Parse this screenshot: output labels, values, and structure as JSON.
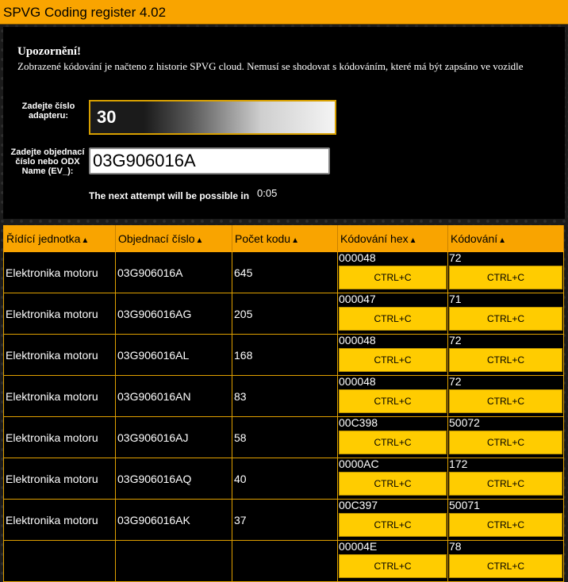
{
  "app": {
    "title": "SPVG Coding register 4.02"
  },
  "notice": {
    "title": "Upozornění!",
    "text": "Zobrazené kódování je načteno z historie SPVG cloud. Nemusí se shodovat s kódováním, které má být zapsáno ve vozidle"
  },
  "form": {
    "adapter_label": "Zadejte číslo adapteru:",
    "adapter_value": "30",
    "part_label": "Zadejte objednací číslo nebo ODX Name (EV_):",
    "part_value": "03G906016A",
    "attempt_text": "The next attempt will be possible in",
    "timer": "0:05"
  },
  "table": {
    "headers": [
      "Řídící jednotka",
      "Objednací číslo",
      "Počet kodu",
      "Kódování hex",
      "Kódování"
    ],
    "sort_glyph": "▲",
    "copy_label": "CTRL+C",
    "rows": [
      {
        "unit": "Elektronika motoru",
        "part": "03G906016A",
        "count": "645",
        "hex": "000048",
        "dec": "72"
      },
      {
        "unit": "Elektronika motoru",
        "part": "03G906016AG",
        "count": "205",
        "hex": "000047",
        "dec": "71"
      },
      {
        "unit": "Elektronika motoru",
        "part": "03G906016AL",
        "count": "168",
        "hex": "000048",
        "dec": "72"
      },
      {
        "unit": "Elektronika motoru",
        "part": "03G906016AN",
        "count": "83",
        "hex": "000048",
        "dec": "72"
      },
      {
        "unit": "Elektronika motoru",
        "part": "03G906016AJ",
        "count": "58",
        "hex": "00C398",
        "dec": "50072"
      },
      {
        "unit": "Elektronika motoru",
        "part": "03G906016AQ",
        "count": "40",
        "hex": "0000AC",
        "dec": "172"
      },
      {
        "unit": "Elektronika motoru",
        "part": "03G906016AK",
        "count": "37",
        "hex": "00C397",
        "dec": "50071"
      },
      {
        "unit": "",
        "part": "",
        "count": "",
        "hex": "00004E",
        "dec": "78"
      }
    ]
  },
  "colors": {
    "accent": "#f9a400",
    "button": "#ffcc00",
    "panel": "#000000"
  }
}
